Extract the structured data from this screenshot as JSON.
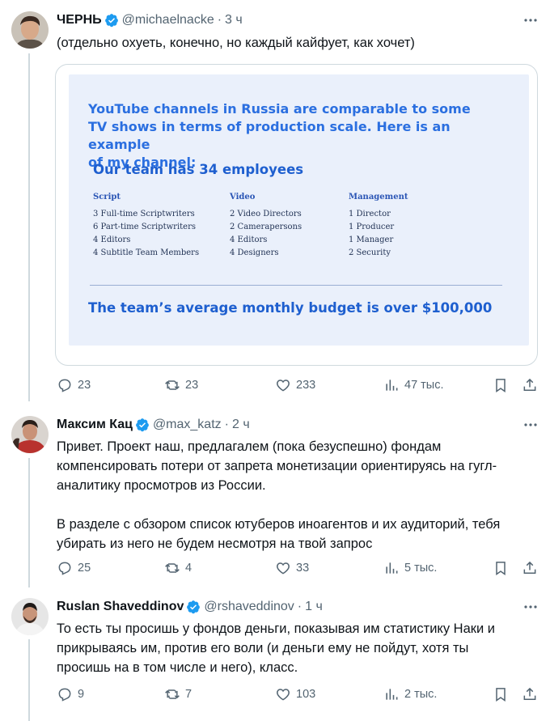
{
  "tweets": [
    {
      "name": "ЧЕРНЬ",
      "handle": "@michaelnacke",
      "time": "3 ч",
      "text": "(отдельно охуеть, конечно, но каждый кайфует, как хочет)",
      "replies": "23",
      "retweets": "23",
      "likes": "233",
      "views": "47 тыс."
    },
    {
      "name": "Максим Кац",
      "handle": "@max_katz",
      "time": "2 ч",
      "text": "Привет. Проект наш, предлагалем (пока безуспешно) фондам\nкомпенсировать потери от запрета монетизации ориентируясь на  гугл-\nаналитику просмотров из России.\n\nВ разделе с обзором список ютуберов иноагентов и их аудиторий, тебя\nубирать из него не будем несмотря на твой запрос",
      "replies": "25",
      "retweets": "4",
      "likes": "33",
      "views": "5 тыс."
    },
    {
      "name": "Ruslan Shaveddinov",
      "handle": "@rshaveddinov",
      "time": "1 ч",
      "text": "То есть ты просишь у фондов деньги, показывая им статистику Наки и\nприкрываясь им, против его воли (и деньги ему не пойдут, хотя ты\nпросишь на в том числе и него), класс.",
      "replies": "9",
      "retweets": "7",
      "likes": "103",
      "views": "2 тыс."
    }
  ],
  "slide": {
    "intro": "YouTube channels in Russia are comparable to some\nTV shows in terms of production scale. Here is an example\nof my channel:",
    "team": "Our team has 34 employees",
    "columns": [
      {
        "head": "Script",
        "items": [
          "3 Full-time Scriptwriters",
          "6 Part-time Scriptwriters",
          "4 Editors",
          "4 Subtitle Team Members"
        ]
      },
      {
        "head": "Video",
        "items": [
          "2 Video Directors",
          "2 Camerapersons",
          "4 Editors",
          "4 Designers"
        ]
      },
      {
        "head": "Management",
        "items": [
          "1 Director",
          "1 Producer",
          "1 Manager",
          "2 Security"
        ]
      }
    ],
    "budget": "The team’s average monthly budget is over $100,000"
  },
  "colors": {
    "verified": "#1d9bf0",
    "muted": "#536471",
    "slide_bg": "#eaf0fb",
    "slide_text": "#1e5fcf"
  },
  "icons": [
    "verified-badge-icon",
    "more-icon",
    "reply-icon",
    "retweet-icon",
    "like-icon",
    "views-icon",
    "bookmark-icon",
    "share-icon"
  ]
}
